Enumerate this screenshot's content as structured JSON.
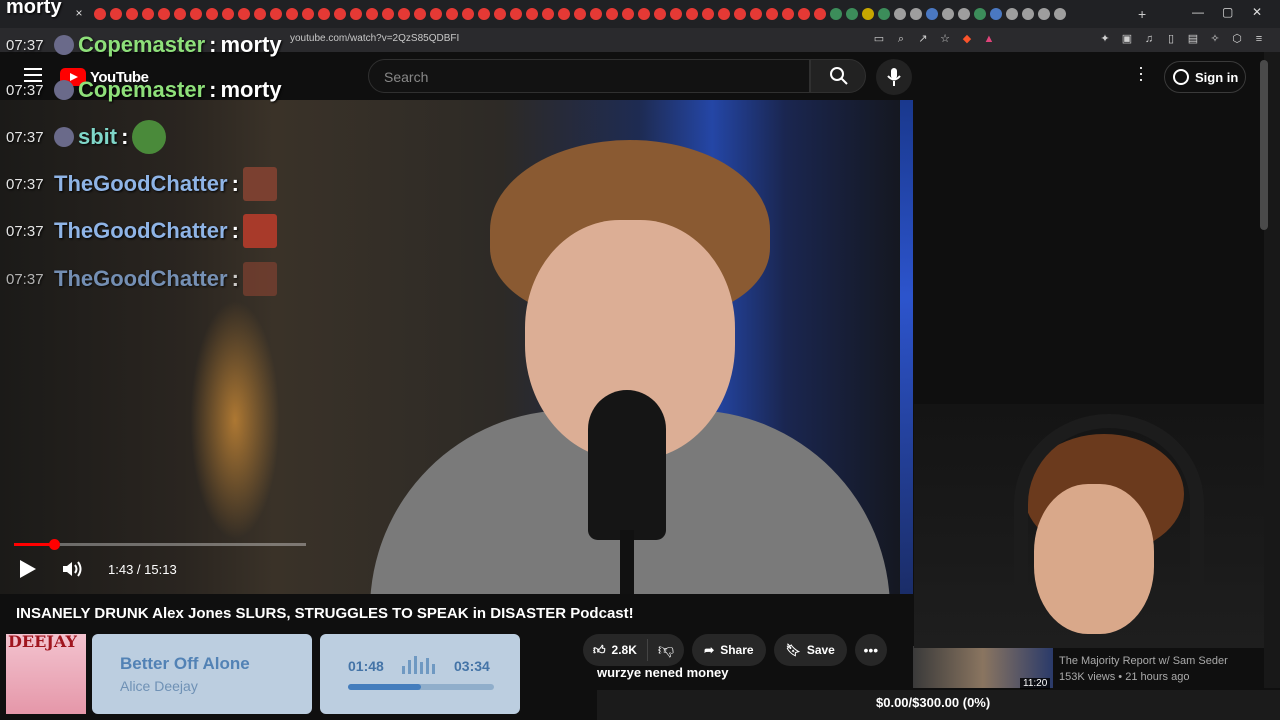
{
  "browser": {
    "url": "youtube.com/watch?v=2QzS85QDBFI",
    "new_tab_label": "+",
    "close_tab": "×"
  },
  "youtube": {
    "logo_text": "YouTube",
    "search_placeholder": "Search",
    "sign_in": "Sign in"
  },
  "chat": {
    "top_username": "morty",
    "messages": [
      {
        "time": "07:37",
        "user": "Copemaster",
        "message": "morty",
        "color": "#8ee07a"
      },
      {
        "time": "07:37",
        "user": "Copemaster",
        "message": "morty",
        "color": "#8ee07a"
      },
      {
        "time": "07:37",
        "user": "sbit",
        "message": "",
        "color": "#7fd6c8",
        "emote": "pepe-frog"
      },
      {
        "time": "07:37",
        "user": "TheGoodChatter",
        "message": "",
        "color": "#8fb4e6",
        "emote": "face-emote"
      },
      {
        "time": "07:37",
        "user": "TheGoodChatter",
        "message": "",
        "color": "#8fb4e6",
        "emote": "face-emote"
      },
      {
        "time": "07:37",
        "user": "TheGoodChatter",
        "message": "",
        "color": "#8fb4e6",
        "emote": "face-emote"
      }
    ],
    "separator": ":"
  },
  "player": {
    "current_time": "1:43",
    "duration": "15:13",
    "time_display": "1:43 / 15:13",
    "progress_fraction": 0.113
  },
  "video": {
    "title": "INSANELY DRUNK Alex Jones SLURS, STRUGGLES TO SPEAK in DISASTER Podcast!",
    "likes": "2.8K",
    "share_label": "Share",
    "save_label": "Save"
  },
  "overlay": {
    "donation_message": "wurzye nened money",
    "goal_text": "$0.00/$300.00 (0%)"
  },
  "now_playing": {
    "album_brand": "DEEJAY",
    "title": "Better Off Alone",
    "artist": "Alice Deejay",
    "elapsed": "01:48",
    "total": "03:34",
    "progress_fraction": 0.5
  },
  "related": {
    "duration": "11:20",
    "channel": "The Majority Report w/ Sam Seder",
    "meta": "153K views • 21 hours ago"
  },
  "colors": {
    "youtube_red": "#ff0000",
    "background": "#0f0f0f"
  }
}
